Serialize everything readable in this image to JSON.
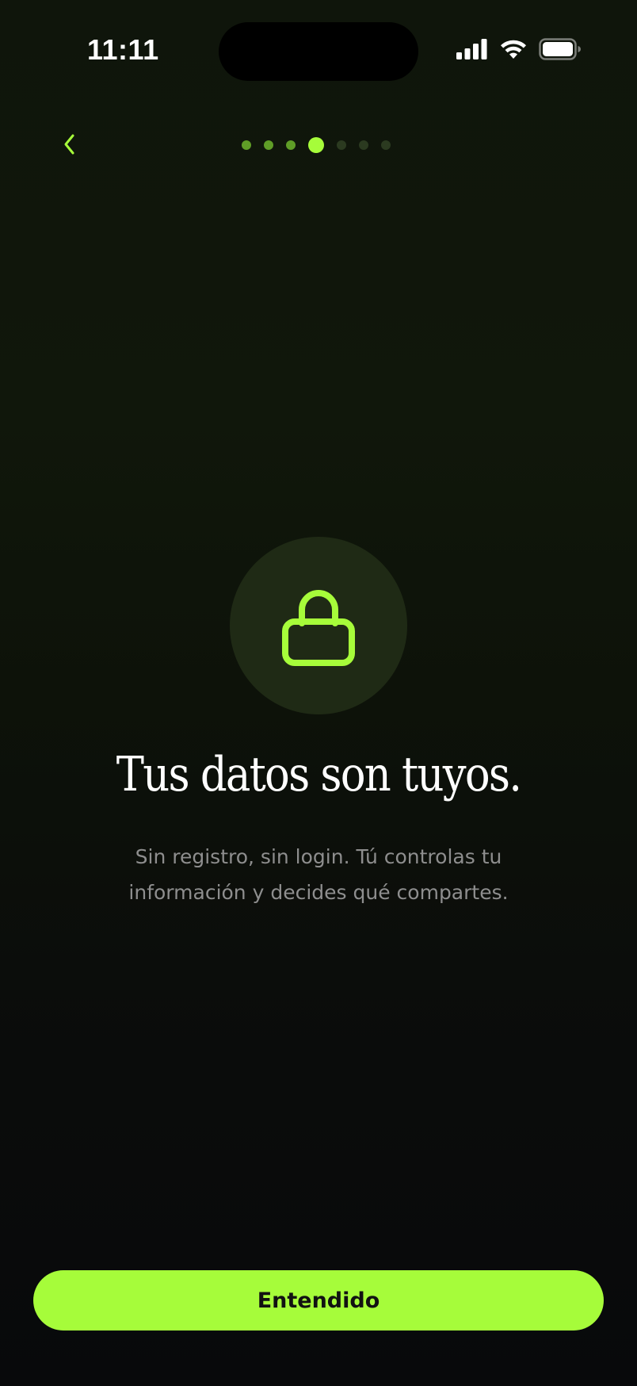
{
  "status_bar": {
    "time": "11:11"
  },
  "nav": {
    "back_icon": "chevron-left-icon",
    "progress": {
      "total_steps": 7,
      "current_step": 4
    }
  },
  "content": {
    "icon": "lock-icon",
    "headline": "Tus datos son tuyos.",
    "subtitle_line1": "Sin registro, sin login. Tú controlas tu",
    "subtitle_line2": "información y decides qué compartes."
  },
  "cta": {
    "label": "Entendido"
  },
  "colors": {
    "accent": "#a6fc3a",
    "icon_circle": "#1f2a15",
    "subtitle": "#8e8e8e",
    "background": "#0b0d0b"
  }
}
